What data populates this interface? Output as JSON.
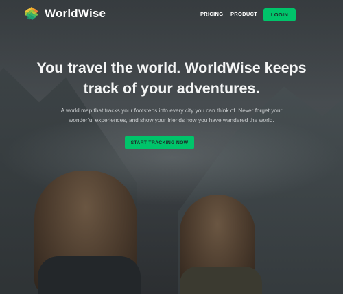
{
  "brand": {
    "name": "WorldWise",
    "logo_icon": "globe-grid-icon",
    "accent_color": "#00c46a"
  },
  "nav": {
    "items": [
      {
        "label": "PRICING"
      },
      {
        "label": "PRODUCT"
      }
    ],
    "login_label": "LOGIN"
  },
  "hero": {
    "title_line1": "You travel the world. WorldWise keeps",
    "title_line2": "track of your adventures.",
    "description_line1": "A world map that tracks your footsteps into every city you can think of. Never forget your",
    "description_line2": "wonderful experiences, and show your friends how you have wandered the world.",
    "cta_label": "START TRACKING NOW"
  }
}
